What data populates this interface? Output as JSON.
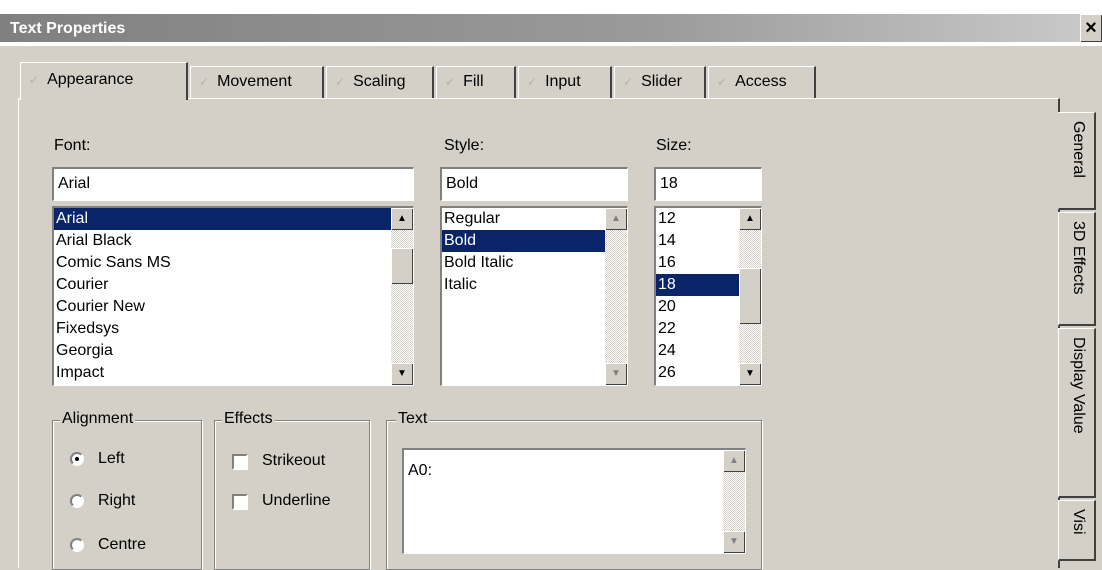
{
  "window": {
    "title": "Text Properties",
    "close_glyph": "×"
  },
  "tabs": [
    "Appearance",
    "Movement",
    "Scaling",
    "Fill",
    "Input",
    "Slider",
    "Access"
  ],
  "side_tabs": [
    "General",
    "3D Effects",
    "Display Value",
    "Visi"
  ],
  "font": {
    "label": "Font:",
    "value": "Arial",
    "options": [
      "Arial",
      "Arial Black",
      "Comic Sans MS",
      "Courier",
      "Courier New",
      "Fixedsys",
      "Georgia",
      "Impact"
    ],
    "selected": "Arial"
  },
  "style": {
    "label": "Style:",
    "value": "Bold",
    "options": [
      "Regular",
      "Bold",
      "Bold Italic",
      "Italic"
    ],
    "selected": "Bold"
  },
  "size": {
    "label": "Size:",
    "value": "18",
    "options": [
      "12",
      "14",
      "16",
      "18",
      "20",
      "22",
      "24",
      "26"
    ],
    "selected": "18"
  },
  "alignment": {
    "label": "Alignment",
    "options": [
      "Left",
      "Right",
      "Centre"
    ],
    "selected": "Left"
  },
  "effects": {
    "label": "Effects",
    "strikeout": "Strikeout",
    "underline": "Underline"
  },
  "text": {
    "label": "Text",
    "value": "A0:"
  },
  "icons": {
    "check": "check-mark-icon",
    "up": "arrow-up-icon",
    "down": "arrow-down-icon"
  },
  "colors": {
    "selection": "#0a246a",
    "dialog": "#d4d0c8"
  }
}
